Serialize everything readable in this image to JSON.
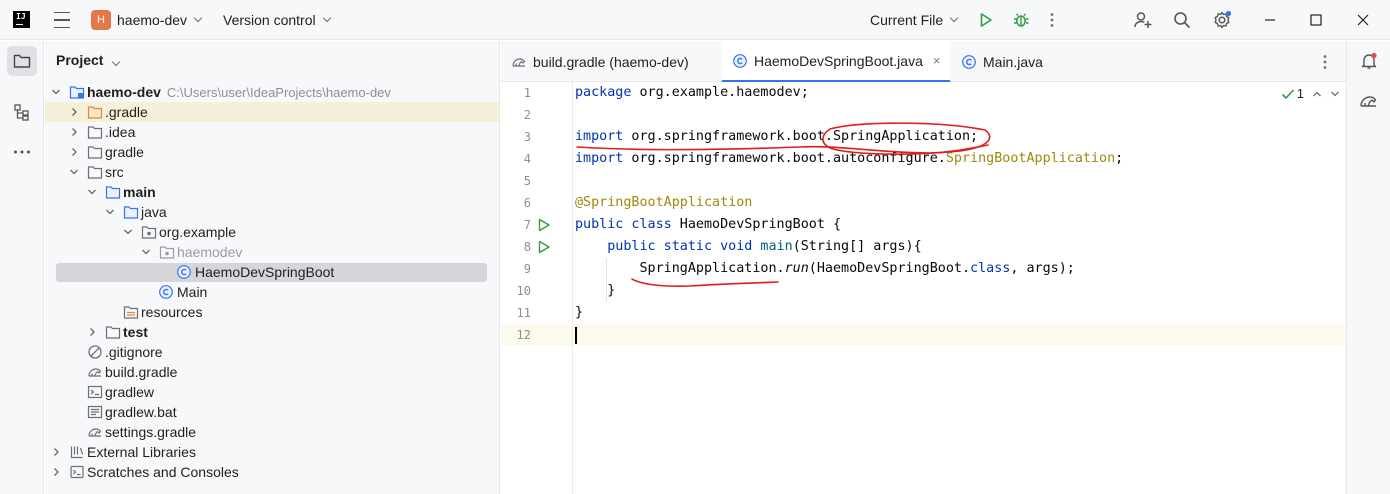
{
  "titlebar": {
    "logo_text": "IJ",
    "project_badge": "H",
    "project_name": "haemo-dev",
    "vcs_label": "Version control",
    "run_config": "Current File",
    "accent_color": "#3574f0",
    "badge_color": "#e57849"
  },
  "project_panel": {
    "title": "Project",
    "tree": [
      {
        "label": "haemo-dev",
        "path": "C:\\Users\\user\\IdeaProjects\\haemo-dev",
        "icon": "module-folder-icon"
      },
      {
        "label": ".gradle",
        "icon": "folder-excluded-icon"
      },
      {
        "label": ".idea",
        "icon": "folder-icon"
      },
      {
        "label": "gradle",
        "icon": "folder-icon"
      },
      {
        "label": "src",
        "icon": "folder-icon"
      },
      {
        "label": "main",
        "icon": "source-folder-icon"
      },
      {
        "label": "java",
        "icon": "source-root-icon"
      },
      {
        "label": "org.example",
        "icon": "package-icon"
      },
      {
        "label": "haemodev",
        "icon": "package-icon"
      },
      {
        "label": "HaemoDevSpringBoot",
        "icon": "class-icon"
      },
      {
        "label": "Main",
        "icon": "class-icon"
      },
      {
        "label": "resources",
        "icon": "resources-folder-icon"
      },
      {
        "label": "test",
        "icon": "folder-icon"
      },
      {
        "label": ".gitignore",
        "icon": "gitignore-icon"
      },
      {
        "label": "build.gradle",
        "icon": "gradle-icon"
      },
      {
        "label": "gradlew",
        "icon": "terminal-file-icon"
      },
      {
        "label": "gradlew.bat",
        "icon": "bat-file-icon"
      },
      {
        "label": "settings.gradle",
        "icon": "gradle-icon"
      },
      {
        "label": "External Libraries",
        "icon": "libraries-icon"
      },
      {
        "label": "Scratches and Consoles",
        "icon": "scratches-icon"
      }
    ]
  },
  "tabs": [
    {
      "label": "build.gradle (haemo-dev)",
      "icon": "gradle-icon"
    },
    {
      "label": "HaemoDevSpringBoot.java",
      "icon": "class-icon",
      "close": "×"
    },
    {
      "label": "Main.java",
      "icon": "class-icon"
    }
  ],
  "editor": {
    "inspection_count": "1",
    "line_numbers": [
      "1",
      "2",
      "3",
      "4",
      "5",
      "6",
      "7",
      "8",
      "9",
      "10",
      "11",
      "12"
    ],
    "code": {
      "l1_kw": "package",
      "l1_rest": " org.example.haemodev;",
      "l3_kw": "import",
      "l3_rest": " org.springframework.boot.SpringApplication;",
      "l4_kw": "import",
      "l4_rest": " org.springframework.boot.autoconfigure.",
      "l4_cls": "SpringBootApplication",
      "l4_end": ";",
      "l6_ann": "@SpringBootApplication",
      "l7_kw": "public class",
      "l7_rest": " HaemoDevSpringBoot {",
      "l8_kw": "    public static void",
      "l8_mth": " main",
      "l8_rest": "(String[] args){",
      "l9_a": "        SpringApplication.",
      "l9_run": "run",
      "l9_b": "(HaemoDevSpringBoot.",
      "l9_kw": "class",
      "l9_c": ", args);",
      "l10": "    }",
      "l11": "}"
    }
  },
  "annotations": {
    "color": "#e11d1d"
  }
}
